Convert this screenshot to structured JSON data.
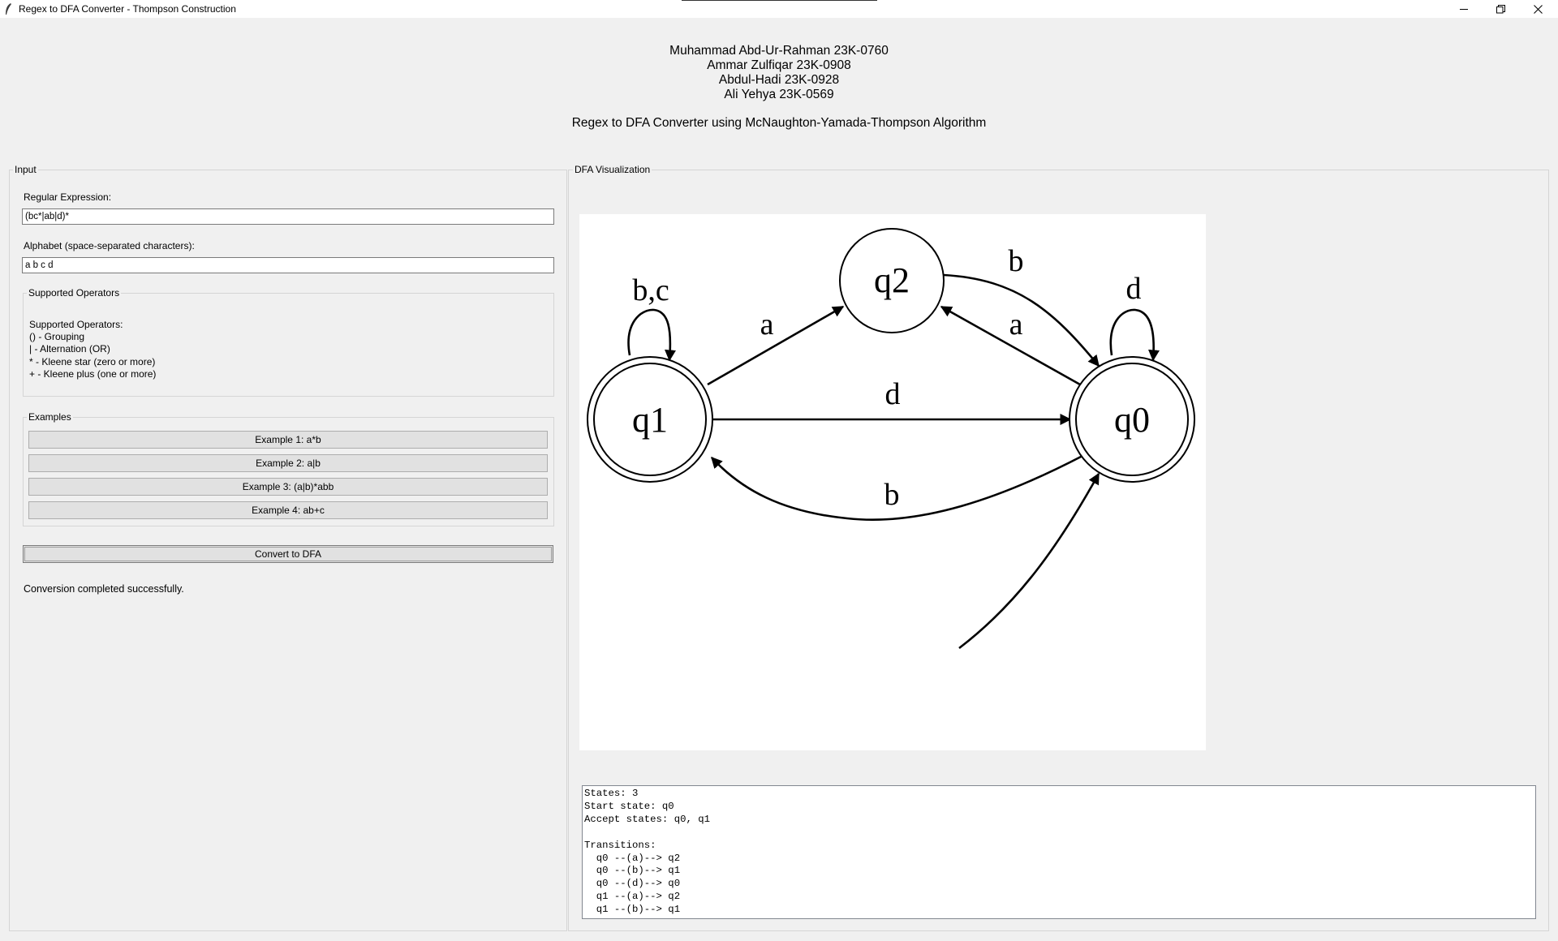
{
  "window": {
    "title": "Regex to DFA Converter - Thompson Construction",
    "controls": [
      "minimize",
      "restore",
      "close"
    ]
  },
  "header": {
    "authors": [
      "Muhammad Abd-Ur-Rahman 23K-0760",
      "Ammar Zulfiqar 23K-0908",
      "Abdul-Hadi 23K-0928",
      "Ali Yehya 23K-0569"
    ],
    "subtitle": "Regex to DFA Converter using McNaughton-Yamada-Thompson Algorithm"
  },
  "input_panel": {
    "title": "Input",
    "regex_label": "Regular Expression:",
    "regex_value": "(bc*|ab|d)*",
    "alphabet_label": "Alphabet (space-separated characters):",
    "alphabet_value": "a b c d",
    "operators": {
      "title": "Supported Operators",
      "heading": "Supported Operators:",
      "items": [
        "() - Grouping",
        "| - Alternation (OR)",
        "* - Kleene star (zero or more)",
        "+ - Kleene plus (one or more)"
      ]
    },
    "examples": {
      "title": "Examples",
      "buttons": [
        "Example 1: a*b",
        "Example 2: a|b",
        "Example 3: (a|b)*abb",
        "Example 4: ab+c"
      ]
    },
    "convert_label": "Convert to DFA",
    "status": "Conversion completed successfully."
  },
  "visual_panel": {
    "title": "DFA Visualization",
    "graph": {
      "states": [
        "q0",
        "q1",
        "q2"
      ],
      "start": "q0",
      "accept": [
        "q0",
        "q1"
      ],
      "edge_labels": {
        "q1_self": "b,c",
        "q1_q2": "a",
        "q1_q0": "d",
        "q2_q0": "b",
        "q0_q2": "a",
        "q0_self": "d",
        "q0_q1": "b"
      }
    },
    "output_lines": [
      "States: 3",
      "Start state: q0",
      "Accept states: q0, q1",
      "",
      "Transitions:",
      "  q0 --(a)--> q2",
      "  q0 --(b)--> q1",
      "  q0 --(d)--> q0",
      "  q1 --(a)--> q2",
      "  q1 --(b)--> q1"
    ]
  }
}
